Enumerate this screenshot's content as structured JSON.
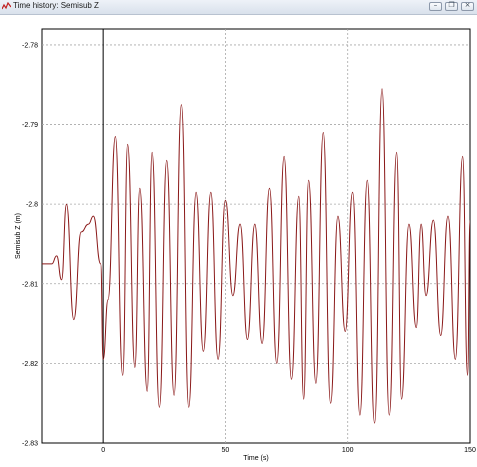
{
  "window": {
    "title": "Time history: Semisub Z",
    "controls": [
      "minimize",
      "restore",
      "close"
    ],
    "control_glyphs": [
      "–",
      "❐",
      "×"
    ]
  },
  "chart_data": {
    "type": "line",
    "xlabel": "Time (s)",
    "ylabel": "Semisub Z (m)",
    "xlim": [
      -25,
      150
    ],
    "ylim": [
      -2.83,
      -2.778
    ],
    "x_ticks": [
      0,
      50,
      100,
      150
    ],
    "y_ticks": [
      -2.78,
      -2.79,
      -2.8,
      -2.81,
      -2.82,
      -2.83
    ],
    "x_tick_labels": [
      "0",
      "50",
      "100",
      "150"
    ],
    "y_tick_labels": [
      "-2.78",
      "-2.79",
      "-2.8",
      "-2.81",
      "-2.82",
      "-2.83"
    ],
    "grid": true,
    "vertical_marker_x": 0,
    "series": [
      {
        "color": "#8b1a1a",
        "x": [
          -25,
          -21,
          -19,
          -17,
          -15,
          -12,
          -9,
          -6,
          -4,
          -1,
          0,
          2,
          5,
          8,
          10,
          13,
          15,
          18,
          20,
          23,
          26,
          29,
          32,
          35,
          38,
          41,
          44,
          47,
          50,
          53,
          56,
          59,
          62,
          65,
          68,
          71,
          74,
          77,
          80,
          82,
          84,
          87,
          90,
          93,
          96,
          99,
          102,
          105,
          108,
          111,
          114,
          117,
          120,
          122,
          125,
          128,
          130,
          132,
          135,
          138,
          141,
          144,
          147,
          149,
          150
        ],
        "y": [
          -2.8075,
          -2.8075,
          -2.8065,
          -2.8095,
          -2.8,
          -2.8145,
          -2.8035,
          -2.8025,
          -2.8015,
          -2.8075,
          -2.8195,
          -2.812,
          -2.7915,
          -2.8215,
          -2.7925,
          -2.8205,
          -2.798,
          -2.8235,
          -2.7935,
          -2.8255,
          -2.7945,
          -2.824,
          -2.7875,
          -2.8255,
          -2.7985,
          -2.8185,
          -2.7985,
          -2.8195,
          -2.7995,
          -2.8115,
          -2.8025,
          -2.817,
          -2.8025,
          -2.8175,
          -2.798,
          -2.82,
          -2.794,
          -2.822,
          -2.799,
          -2.8245,
          -2.797,
          -2.8225,
          -2.791,
          -2.825,
          -2.8015,
          -2.816,
          -2.7985,
          -2.8265,
          -2.797,
          -2.8275,
          -2.7855,
          -2.8265,
          -2.7935,
          -2.8245,
          -2.8025,
          -2.8155,
          -2.8025,
          -2.8115,
          -2.802,
          -2.8165,
          -2.8015,
          -2.8195,
          -2.794,
          -2.8215,
          -2.802
        ]
      }
    ]
  }
}
